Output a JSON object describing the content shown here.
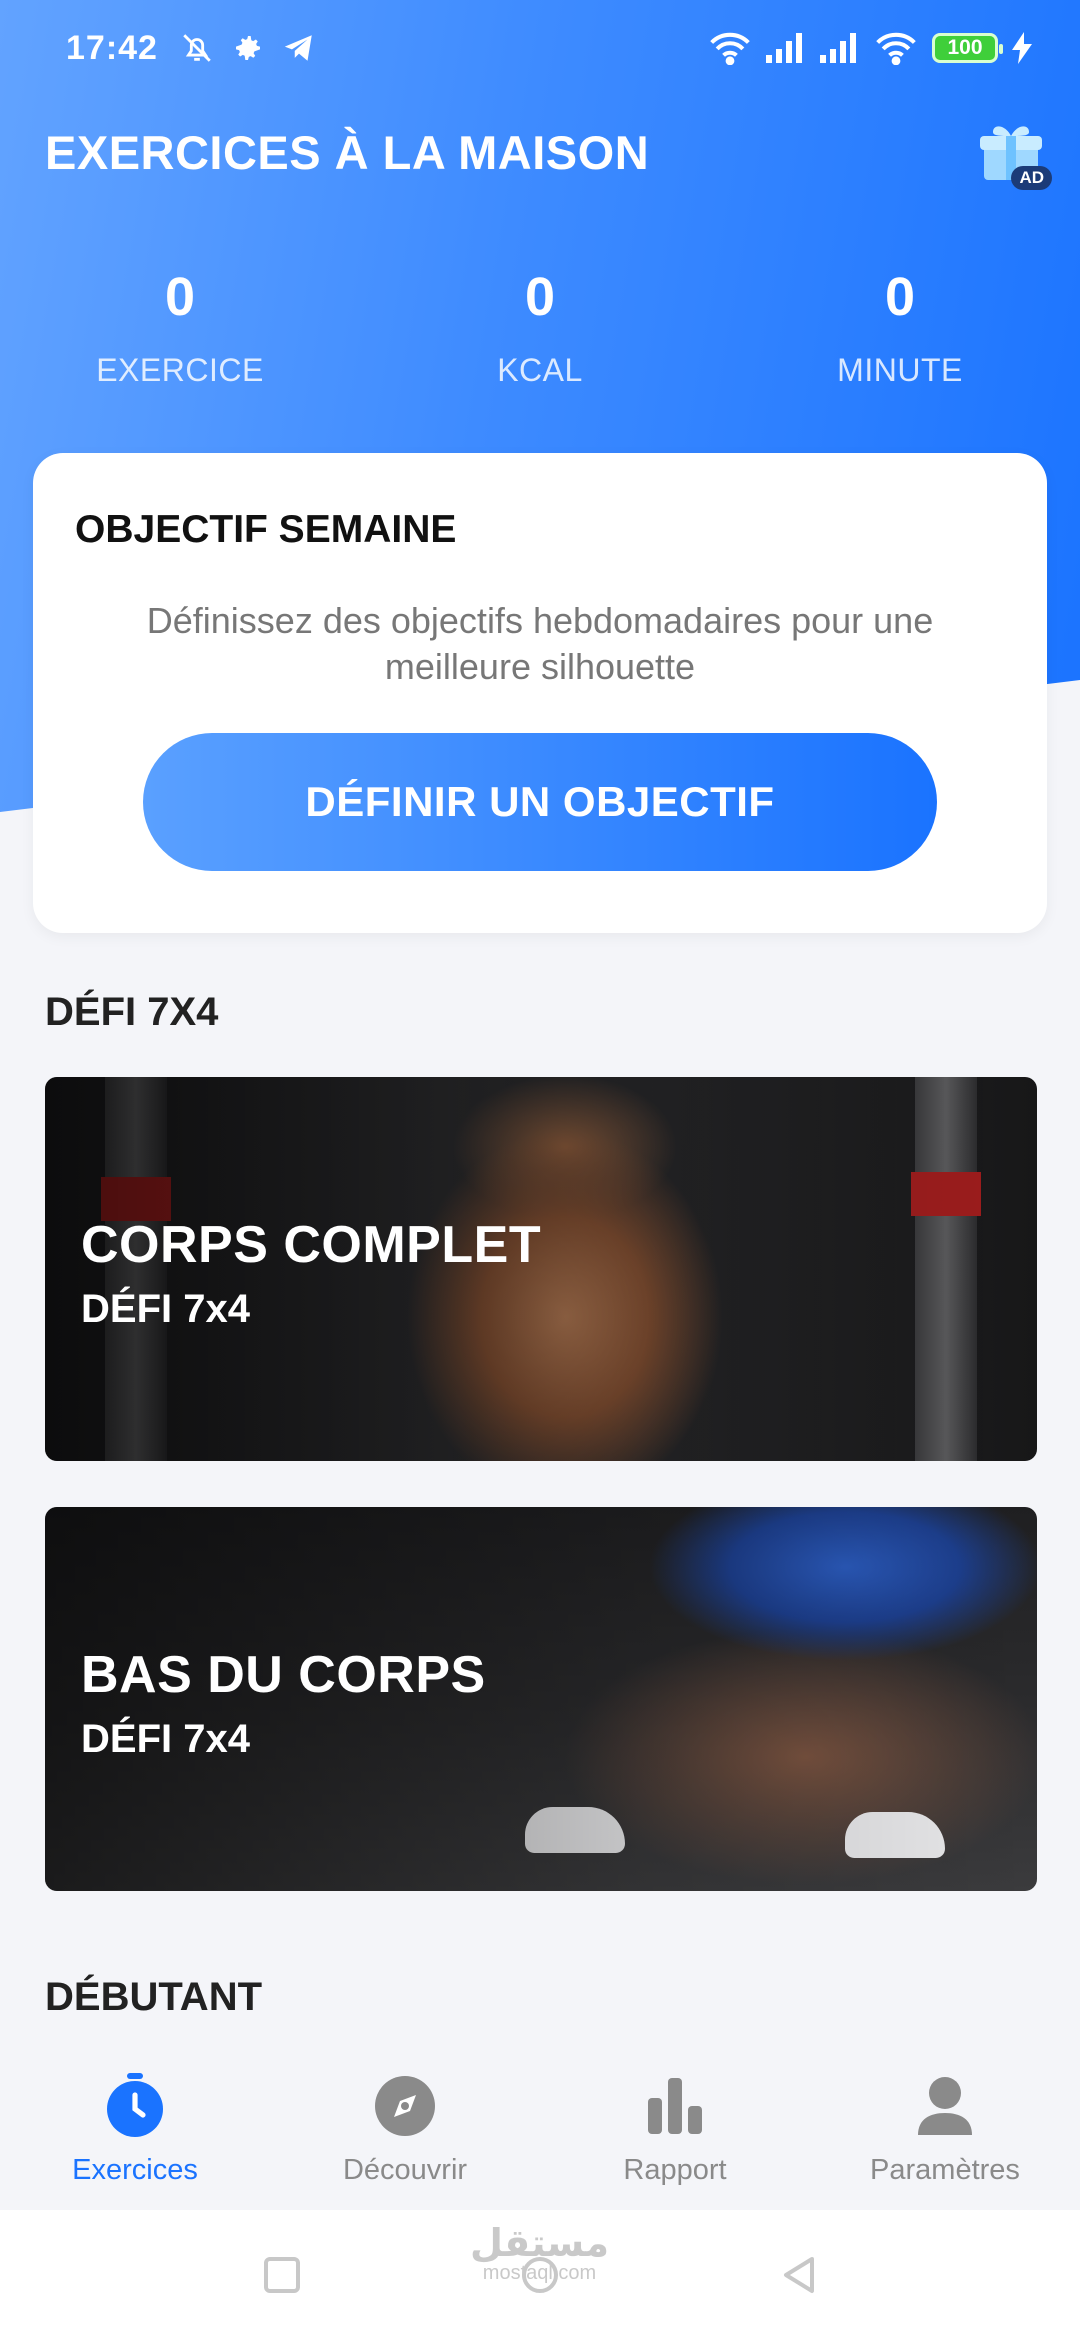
{
  "status_bar": {
    "time": "17:42",
    "battery": "100"
  },
  "header": {
    "title": "EXERCICES À LA MAISON",
    "ad_badge": "AD"
  },
  "stats": [
    {
      "value": "0",
      "label": "EXERCICE"
    },
    {
      "value": "0",
      "label": "KCAL"
    },
    {
      "value": "0",
      "label": "MINUTE"
    }
  ],
  "goal_card": {
    "title": "OBJECTIF SEMAINE",
    "description": "Définissez des objectifs hebdomadaires pour une meilleure silhouette",
    "button_label": "DÉFINIR UN OBJECTIF"
  },
  "challenge_section": {
    "title": "DÉFI 7X4",
    "cards": [
      {
        "title": "CORPS COMPLET",
        "subtitle": "DÉFI 7x4"
      },
      {
        "title": "BAS DU CORPS",
        "subtitle": "DÉFI 7x4"
      }
    ]
  },
  "beginner_section": {
    "title": "DÉBUTANT"
  },
  "bottom_nav": {
    "items": [
      {
        "label": "Exercices",
        "icon": "stopwatch-icon",
        "active": true
      },
      {
        "label": "Découvrir",
        "icon": "compass-icon",
        "active": false
      },
      {
        "label": "Rapport",
        "icon": "bar-chart-icon",
        "active": false
      },
      {
        "label": "Paramètres",
        "icon": "person-icon",
        "active": false
      }
    ]
  },
  "watermark": {
    "text": "مستقل",
    "subtext": "mostaql.com"
  },
  "colors": {
    "accent": "#1a73ff",
    "header_gradient_start": "#62a3ff",
    "inactive_nav": "#8a8a8a"
  }
}
